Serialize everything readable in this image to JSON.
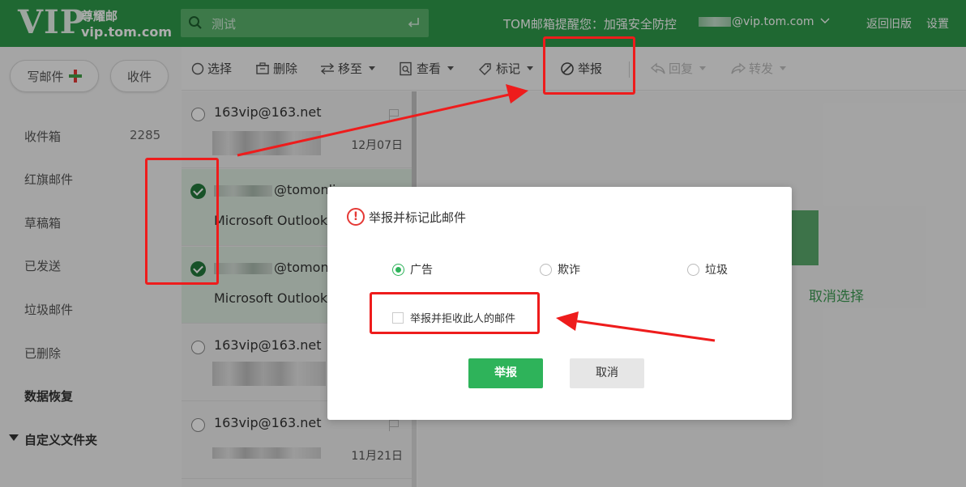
{
  "header": {
    "logo_vip": "VIP",
    "logo_name": "尊耀邮",
    "logo_domain": "vip.tom.com",
    "search_value": "测试",
    "notice": "TOM邮箱提醒您：加强安全防控",
    "account_email": "@vip.tom.com",
    "links": [
      "返回旧版",
      "设置"
    ]
  },
  "sidebar": {
    "compose_label": "写邮件",
    "receive_label": "收件",
    "folders": [
      {
        "label": "收件箱",
        "count": "2285"
      },
      {
        "label": "红旗邮件"
      },
      {
        "label": "草稿箱"
      },
      {
        "label": "已发送"
      },
      {
        "label": "垃圾邮件"
      },
      {
        "label": "已删除"
      },
      {
        "label": "数据恢复"
      },
      {
        "label": "自定义文件夹"
      }
    ]
  },
  "toolbar": {
    "select": "选择",
    "delete": "删除",
    "move": "移至",
    "view": "查看",
    "mark": "标记",
    "report": "举报",
    "reply": "回复",
    "forward": "转发"
  },
  "messages": [
    {
      "sender": "163vip@163.net",
      "date": "12月07日",
      "selected": false
    },
    {
      "sender": "@tomonli",
      "subject": "Microsoft Outlook",
      "selected": true
    },
    {
      "sender": "@tomonli",
      "subject": "Microsoft Outlook",
      "selected": true
    },
    {
      "sender": "163vip@163.net",
      "selected": false
    },
    {
      "sender": "163vip@163.net",
      "date": "11月21日",
      "selected": false
    }
  ],
  "preview": {
    "cancel_selection": "取消选择"
  },
  "dialog": {
    "title": "举报并标记此邮件",
    "options": [
      "广告",
      "欺诈",
      "垃圾"
    ],
    "selected_option": "广告",
    "reject_label": "举报并拒收此人的邮件",
    "reject_checked": false,
    "report_button": "举报",
    "cancel_button": "取消"
  },
  "colors": {
    "header_green": "#2e9a4a",
    "accent_green": "#2eb35a",
    "annotation_red": "#ee1c1c"
  }
}
